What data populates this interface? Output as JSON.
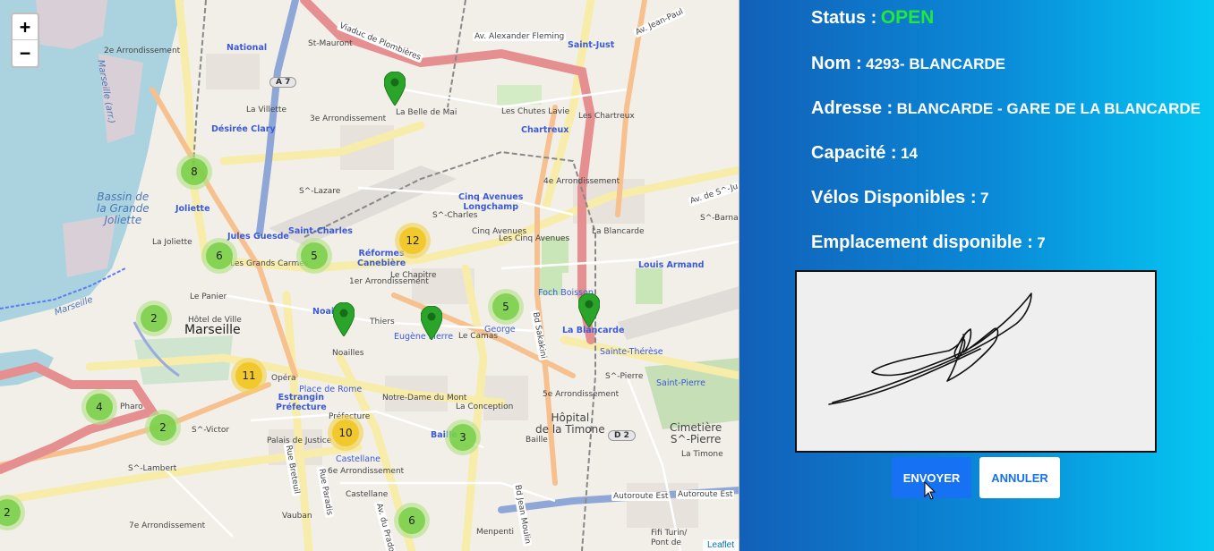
{
  "map": {
    "zoom_in": "+",
    "zoom_out": "−",
    "attribution": "Leaflet",
    "labels": {
      "marseille": "Marseille",
      "arr2": "2e Arrondissement",
      "arr3": "3e Arrondissement",
      "arr1": "1er Arrondissement",
      "arr4": "4e Arrondissement",
      "arr5": "5e Arrondissement",
      "arr6": "6e Arrondissement",
      "arr7": "7e Arrondissement",
      "national": "National",
      "st_mauront": "St-Mauront",
      "la_villette": "La Villette",
      "desiree_clary": "Désirée Clary",
      "joliette": "Joliette",
      "la_joliette": "La Joliette",
      "jules_guesde": "Jules Guesde",
      "saint_charles": "Saint-Charles",
      "s_charles": "S^-Charles",
      "reformes": "Réformes\nCanebière",
      "cinq_avenues": "Cinq Avenues\nLongchamp",
      "cinq_avenues_2": "Cinq Avenues",
      "les_cinq_avenues": "Les Cinq Avenues",
      "chartreux": "Chartreux",
      "les_chartreux": "Les Chartreux",
      "les_chutes": "Les Chutes Lavie",
      "saint_just": "Saint-Just",
      "la_belle_de_mai": "La Belle de Mai",
      "st_lazare": "S^-Lazare",
      "le_panier": "Le Panier",
      "les_grands_carmes": "Les Grands Carmes",
      "hotel_de_ville": "Hôtel de Ville",
      "noailles": "Noailles",
      "noailles_top": "Noai",
      "thiers": "Thiers",
      "le_camas": "Le Camas",
      "eugene_pierre": "Eugène Pierre",
      "george": "George",
      "foch_boisson": "Foch Boisson",
      "la_blancarde": "La Blancarde",
      "la_blancarde_2": "La Blancarde",
      "louis_armand": "Louis Armand",
      "sainte_therese": "Sainte-Thérèse",
      "saint_pierre": "Saint-Pierre",
      "st_pierre": "S^-Pierre",
      "cimetiere": "Cimetière\nS^-Pierre",
      "la_timone_hop": "Hôpital\nde la Timone",
      "baille": "Baille",
      "baille_2": "Baille",
      "la_conception": "La Conception",
      "notre_dame_du_mont": "Notre-Dame du Mont",
      "place_de_rome": "Place de Rome",
      "estrangin": "Estrangin\nPréfecture",
      "prefecture": "Préfecture",
      "opera": "Opéra",
      "palais_justice": "Palais de Justice",
      "st_victor": "S^-Victor",
      "st_lambert": "S^-Lambert",
      "pharo": "Pharo",
      "castellane": "Castellane",
      "castellane_2": "Castellane",
      "vauban": "Vauban",
      "menpenti": "Menpenti",
      "fifi_turin": "Fifi Turin/\nPont de",
      "la_timone": "La Timone",
      "st_barnabe": "S^-Barnabé",
      "le_chapitre": "Le Chapitre",
      "bassin": "Bassin de\nla Grande\nJoliette",
      "marseille_arr": "Marseille (arr.)",
      "marseille_arr2": "Marseille",
      "a7": "A 7",
      "d2": "D 2",
      "viaduc": "Viaduc de Plombières",
      "av_fleming": "Av. Alexander Fleming",
      "av_jean_paul": "Av. Jean-Paul",
      "av_st_just": "Av. de S^-Ju",
      "autoroute_est": "Autoroute Est",
      "autoroute_est2": "Autoroute Est",
      "bd_sakakini": "Bd Sakakini",
      "bd_jean_moulin": "Bd Jean Moulin",
      "rue_breteuil": "Rue Breteuil",
      "rue_paradis": "Rue Paradis",
      "av_prado": "Av. du Prado"
    },
    "clusters": [
      {
        "count": "8",
        "color": "green"
      },
      {
        "count": "6",
        "color": "green"
      },
      {
        "count": "5",
        "color": "green"
      },
      {
        "count": "12",
        "color": "yellow"
      },
      {
        "count": "2",
        "color": "green"
      },
      {
        "count": "11",
        "color": "yellow"
      },
      {
        "count": "5",
        "color": "green"
      },
      {
        "count": "4",
        "color": "green"
      },
      {
        "count": "2",
        "color": "green"
      },
      {
        "count": "10",
        "color": "yellow"
      },
      {
        "count": "3",
        "color": "green"
      },
      {
        "count": "6",
        "color": "green"
      },
      {
        "count": "2",
        "color": "green"
      }
    ]
  },
  "station": {
    "status_label": "Status :",
    "status_value": "OPEN",
    "name_label": "Nom :",
    "name_value": "4293- BLANCARDE",
    "address_label": "Adresse :",
    "address_value": "BLANCARDE - GARE DE LA BLANCARDE",
    "capacity_label": "Capacité :",
    "capacity_value": "14",
    "bikes_label": "Vélos Disponibles :",
    "bikes_value": "7",
    "slots_label": "Emplacement disponible :",
    "slots_value": "7"
  },
  "actions": {
    "send": "ENVOYER",
    "cancel": "ANNULER"
  },
  "colors": {
    "status_open": "#22e83a",
    "send_button": "#1672f2",
    "gradient_start": "#1260b8",
    "gradient_end": "#05c8f2"
  }
}
